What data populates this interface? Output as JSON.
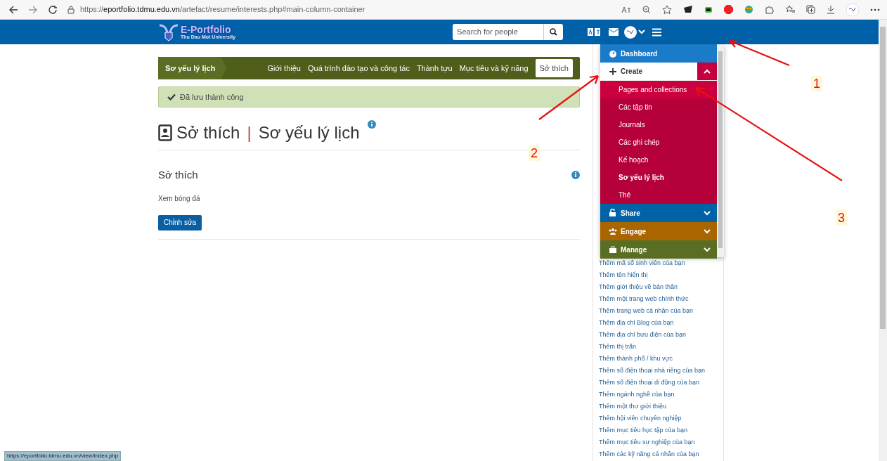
{
  "browser": {
    "url_scheme": "https://",
    "url_host": "eportfolio.tdmu.edu.vn",
    "url_path": "/artefact/resume/interests.php#main-column-container",
    "status_url": "https://eportfolio.tdmu.edu.vn/view/index.php"
  },
  "header": {
    "logo_title": "E-Portfolio",
    "logo_subtitle": "Thu Dau Mot University",
    "search_placeholder": "Search for people"
  },
  "resume_nav": {
    "title": "Sơ yếu lý lịch",
    "tabs": [
      {
        "label": "Giới thiệu",
        "selected": false
      },
      {
        "label": "Quá trình đào tạo và công tác",
        "selected": false
      },
      {
        "label": "Thành tựu",
        "selected": false
      },
      {
        "label": "Mục tiêu và kỹ năng",
        "selected": false
      },
      {
        "label": "Sở thích",
        "selected": true
      }
    ]
  },
  "alert": "Đã lưu thành công",
  "page_title": {
    "main": "Sở thích",
    "separator": "|",
    "section": "Sơ yếu lý lịch"
  },
  "section": {
    "heading": "Sở thích",
    "content": "Xem bóng đá",
    "button": "Chỉnh sửa"
  },
  "menu": {
    "items": [
      {
        "kind": "link",
        "label": "Dashboard",
        "color": "#1a7bc9"
      },
      {
        "kind": "group",
        "label": "Create",
        "color": "#ffffff",
        "expanded": true,
        "children": [
          {
            "label": "Pages and collections",
            "highlighted": true,
            "selected": false
          },
          {
            "label": "Các tập tin",
            "highlighted": false,
            "selected": false
          },
          {
            "label": "Journals",
            "highlighted": false,
            "selected": false
          },
          {
            "label": "Các ghi chép",
            "highlighted": false,
            "selected": false
          },
          {
            "label": "Kế hoạch",
            "highlighted": false,
            "selected": false
          },
          {
            "label": "Sơ yếu lý lịch",
            "highlighted": false,
            "selected": true
          },
          {
            "label": "Thẻ",
            "highlighted": false,
            "selected": false
          }
        ]
      },
      {
        "kind": "group",
        "label": "Share",
        "color": "#0063a6",
        "expanded": false
      },
      {
        "kind": "group",
        "label": "Engage",
        "color": "#a86500",
        "expanded": false
      },
      {
        "kind": "group",
        "label": "Manage",
        "color": "#5a6e23",
        "expanded": false
      }
    ]
  },
  "sidebar_links": [
    "Thêm mã số sinh viên của bạn",
    "Thêm tên hiển thị",
    "Thêm giới thiệu về bản thân",
    "Thêm một trang web chính thức",
    "Thêm trang web cá nhân của bạn",
    "Thêm địa chỉ Blog của bạn",
    "Thêm địa chỉ bưu điện của bạn",
    "Thêm thị trấn",
    "Thêm thành phố / khu vực",
    "Thêm số điện thoại nhà riêng của bạn",
    "Thêm số điện thoại di động của bạn",
    "Thêm ngành nghề của bạn",
    "Thêm một thư giới thiệu",
    "Thêm hội viên chuyên nghiệp",
    "Thêm mục tiêu học tập của bạn",
    "Thêm mục tiêu sự nghiệp của bạn",
    "Thêm các kỹ năng cá nhân của bạn"
  ],
  "annotations": [
    "1",
    "2",
    "3"
  ]
}
